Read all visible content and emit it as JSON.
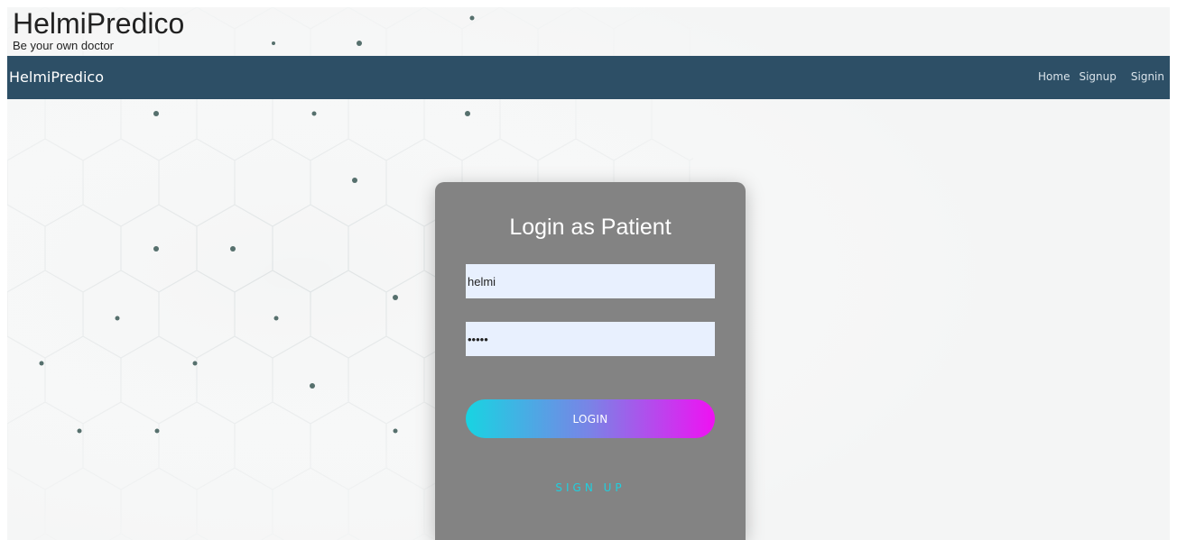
{
  "header": {
    "title": "HelmiPredico",
    "tagline": "Be your own doctor"
  },
  "navbar": {
    "brand": "HelmiPredico",
    "links": {
      "home": "Home",
      "signup": "Signup",
      "signin": "Signin"
    },
    "background": "#2d4f66"
  },
  "login": {
    "title": "Login as Patient",
    "username_value": "helmi",
    "password_value": "helmi",
    "login_label": "LOGIN",
    "signup_label": "SIGN UP",
    "card_color": "#838383",
    "button_gradient": [
      "#18d4e2",
      "#f011f3"
    ]
  }
}
